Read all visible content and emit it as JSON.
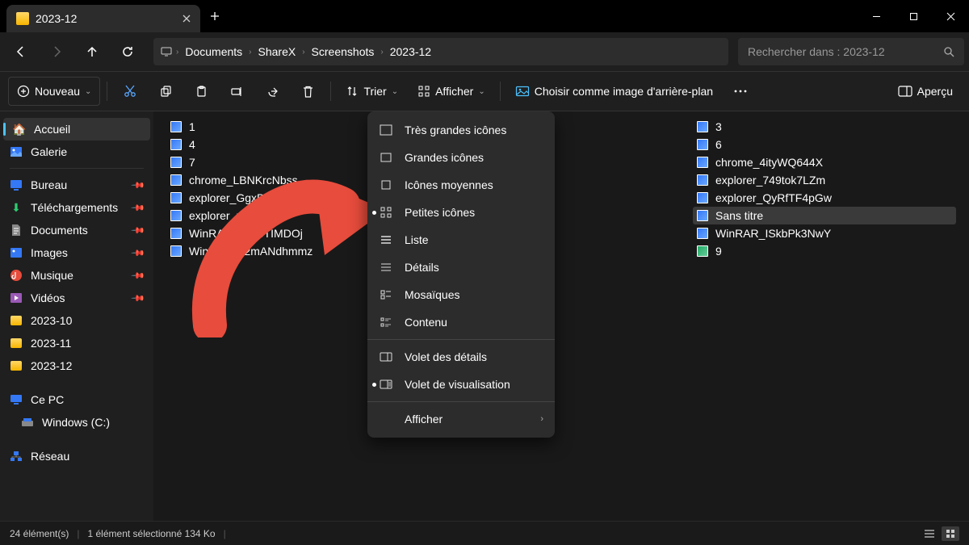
{
  "window": {
    "title": "2023-12"
  },
  "breadcrumb": {
    "items": [
      "Documents",
      "ShareX",
      "Screenshots",
      "2023-12"
    ]
  },
  "search": {
    "placeholder": "Rechercher dans : 2023-12"
  },
  "toolbar": {
    "new": "Nouveau",
    "sort": "Trier",
    "view": "Afficher",
    "background": "Choisir comme image d'arrière-plan",
    "preview": "Aperçu"
  },
  "sidebar": {
    "home": "Accueil",
    "gallery": "Galerie",
    "desktop": "Bureau",
    "downloads": "Téléchargements",
    "documents": "Documents",
    "images": "Images",
    "music": "Musique",
    "videos": "Vidéos",
    "folder_2023_10": "2023-10",
    "folder_2023_11": "2023-11",
    "folder_2023_12": "2023-12",
    "thispc": "Ce PC",
    "windows_c": "Windows (C:)",
    "network": "Réseau"
  },
  "files_col1": [
    {
      "name": "1",
      "type": "img"
    },
    {
      "name": "4",
      "type": "img"
    },
    {
      "name": "7",
      "type": "img"
    },
    {
      "name": "chrome_LBNKrcNbss",
      "type": "img"
    },
    {
      "name": "explorer_GgxDqyufnE",
      "type": "img"
    },
    {
      "name": "explorer_uijF8xhulB",
      "type": "img"
    },
    {
      "name": "WinRAR_7o6eTIMDOj",
      "type": "img"
    },
    {
      "name": "WinRAR_J2mANdhmmz",
      "type": "img"
    }
  ],
  "files_col2": [
    {
      "name": "3",
      "type": "img"
    },
    {
      "name": "6",
      "type": "img"
    },
    {
      "name": "chrome_4ityWQ644X",
      "type": "img"
    },
    {
      "name": "explorer_749tok7LZm",
      "type": "img"
    },
    {
      "name": "explorer_QyRfTF4pGw",
      "type": "img"
    },
    {
      "name": "Sans titre",
      "type": "img",
      "selected": true
    },
    {
      "name": "WinRAR_ISkbPk3NwY",
      "type": "img"
    },
    {
      "name": "9",
      "type": "vid"
    }
  ],
  "view_menu": {
    "extra_large": "Très grandes icônes",
    "large": "Grandes icônes",
    "medium": "Icônes moyennes",
    "small": "Petites icônes",
    "list": "Liste",
    "details": "Détails",
    "tiles": "Mosaïques",
    "content": "Contenu",
    "details_pane": "Volet des détails",
    "preview_pane": "Volet de visualisation",
    "show": "Afficher"
  },
  "status": {
    "count": "24 élément(s)",
    "selected": "1 élément sélectionné  134 Ko"
  }
}
